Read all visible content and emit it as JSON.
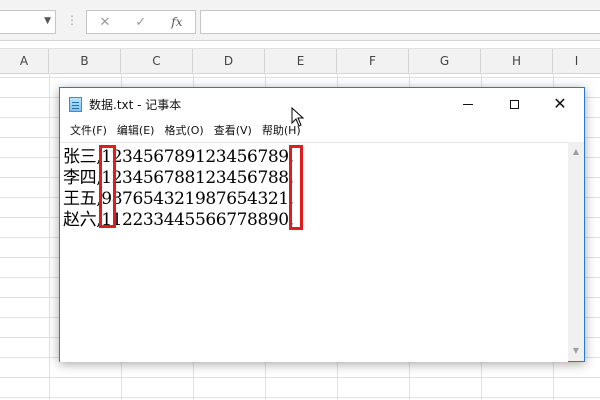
{
  "excel": {
    "namebox_value": "",
    "formula_value": "",
    "fx_label": "fx",
    "columns": [
      "A",
      "B",
      "C",
      "D",
      "E",
      "F",
      "G",
      "H",
      "I"
    ]
  },
  "notepad": {
    "title": "数据.txt - 记事本",
    "menu": [
      "文件(F)",
      "编辑(E)",
      "格式(O)",
      "查看(V)",
      "帮助(H)"
    ],
    "lines": [
      "张三,123456789123456789,",
      "李四,123456788123456788,",
      "王五,987654321987654321,",
      "赵六,112233445566778890,"
    ]
  },
  "colors": {
    "highlight": "#e01c1c",
    "window_border": "#2b78d0"
  }
}
